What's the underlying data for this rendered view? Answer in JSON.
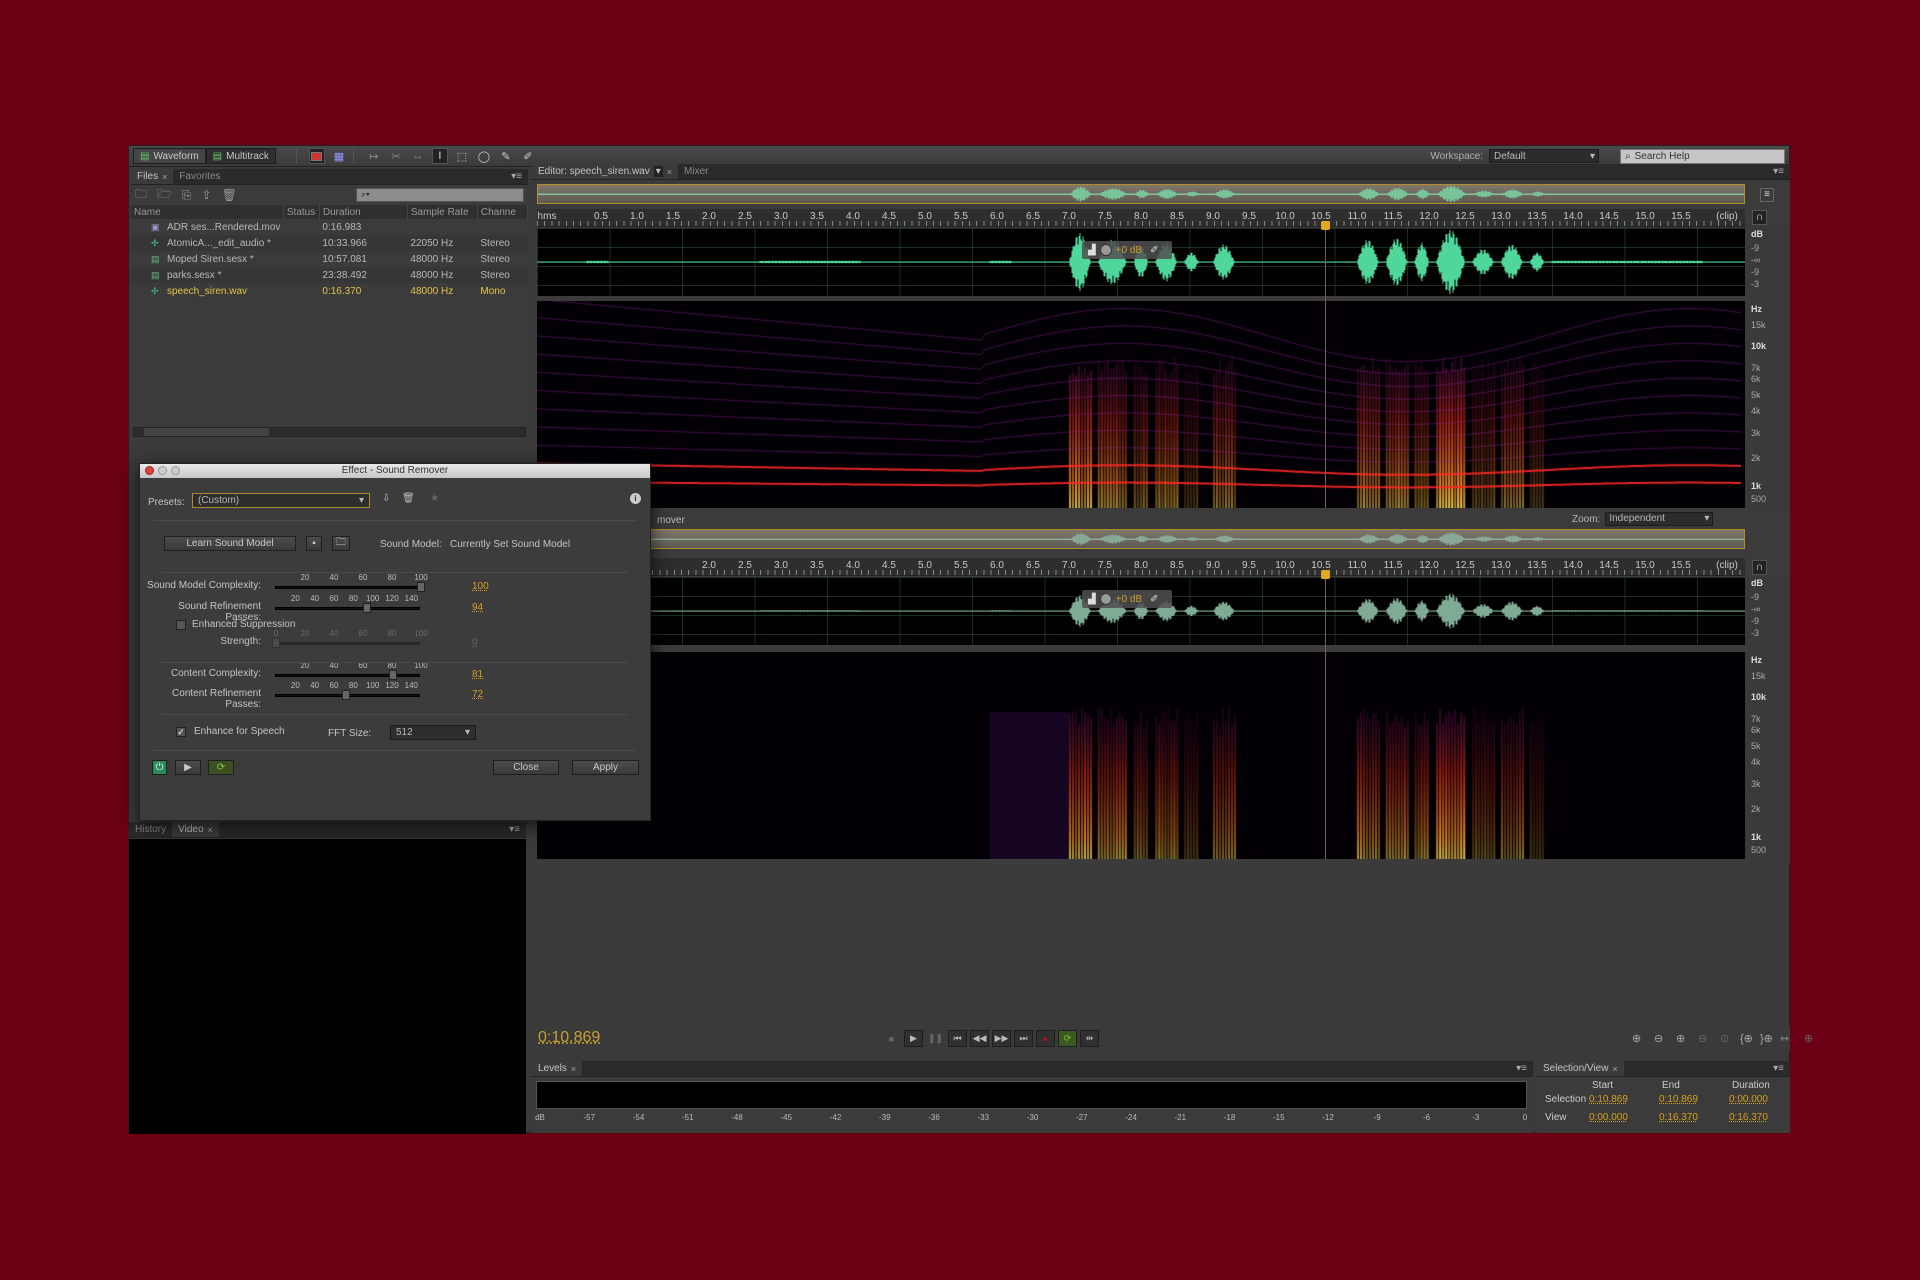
{
  "toolbar": {
    "modes": [
      {
        "label": "Waveform",
        "icon": "waveform-view-icon",
        "active": true
      },
      {
        "label": "Multitrack",
        "icon": "multitrack-view-icon",
        "active": false
      }
    ],
    "tools": [
      "spectral-frequency-display-icon",
      "spectral-pitch-display-icon",
      "move-tool-icon",
      "razor-tool-icon",
      "slip-tool-icon",
      "time-selection-tool-icon",
      "marquee-tool-icon",
      "lasso-tool-icon",
      "paintbrush-tool-icon",
      "spot-healing-brush-icon"
    ],
    "workspace_label": "Workspace:",
    "workspace_value": "Default",
    "search_placeholder": "Search Help"
  },
  "files_panel": {
    "tabs": [
      {
        "label": "Files",
        "closable": true,
        "active": true
      },
      {
        "label": "Favorites",
        "closable": false,
        "active": false
      }
    ],
    "columns": [
      "Name",
      "Status",
      "Duration",
      "Sample Rate",
      "Channe"
    ],
    "rows": [
      {
        "name": "ADR ses...Rendered.mov",
        "type": "video",
        "status": "",
        "duration": "0:16.983",
        "rate": "",
        "channels": ""
      },
      {
        "name": "AtomicA..._edit_audio *",
        "type": "audio",
        "status": "",
        "duration": "10:33.966",
        "rate": "22050 Hz",
        "channels": "Stereo"
      },
      {
        "name": "Moped Siren.sesx *",
        "type": "session",
        "status": "",
        "duration": "10:57.081",
        "rate": "48000 Hz",
        "channels": "Stereo"
      },
      {
        "name": "parks.sesx *",
        "type": "session",
        "status": "",
        "duration": "23:38.492",
        "rate": "48000 Hz",
        "channels": "Stereo"
      },
      {
        "name": "speech_siren.wav",
        "type": "audio",
        "status": "",
        "duration": "0:16.370",
        "rate": "48000 Hz",
        "channels": "Mono",
        "selected": true
      }
    ]
  },
  "history_panel": {
    "tabs": [
      {
        "label": "History",
        "active": false
      },
      {
        "label": "Video",
        "active": true,
        "closable": true
      }
    ]
  },
  "editor": {
    "tabs": [
      {
        "label": "Editor: speech_siren.wav",
        "active": true,
        "closable": true
      },
      {
        "label": "Mixer",
        "active": false
      }
    ],
    "ruler_unit": "hms",
    "ruler_ticks": [
      "0.5",
      "1.0",
      "1.5",
      "2.0",
      "2.5",
      "3.0",
      "3.5",
      "4.0",
      "4.5",
      "5.0",
      "5.5",
      "6.0",
      "6.5",
      "7.0",
      "7.5",
      "8.0",
      "8.5",
      "9.0",
      "9.5",
      "10.0",
      "10.5",
      "11.0",
      "11.5",
      "12.0",
      "12.5",
      "13.0",
      "13.5",
      "14.0",
      "14.5",
      "15.0",
      "15.5"
    ],
    "ruler_end": "(clip)",
    "db_scale": [
      "dB",
      "-9",
      "-∞",
      "-9",
      "-3"
    ],
    "hz_scale": [
      "Hz",
      "15k",
      "10k",
      "7k",
      "6k",
      "5k",
      "4k",
      "3k",
      "2k",
      "1k",
      "500"
    ],
    "hud_gain": "+0 dB",
    "comparison_label": "mover",
    "zoom_label": "Zoom:",
    "zoom_value": "Independent",
    "playhead_time_s": 10.869,
    "duration_s": 16.37
  },
  "dialog": {
    "title": "Effect - Sound Remover",
    "presets_label": "Presets:",
    "presets_value": "(Custom)",
    "learn_button": "Learn Sound Model",
    "sound_model_label": "Sound Model:",
    "sound_model_value": "Currently Set Sound Model",
    "sliders": [
      {
        "label": "Sound Model Complexity:",
        "ticks": [
          "20",
          "40",
          "60",
          "80",
          "100"
        ],
        "min": 0,
        "max": 100,
        "value": "100",
        "enabled": true
      },
      {
        "label": "Sound Refinement Passes:",
        "ticks": [
          "20",
          "40",
          "60",
          "80",
          "100",
          "120",
          "140"
        ],
        "min": 0,
        "max": 150,
        "value": "94",
        "enabled": true
      },
      {
        "label": "Strength:",
        "ticks": [
          "0",
          "20",
          "40",
          "60",
          "80",
          "100"
        ],
        "min": 0,
        "max": 100,
        "value": "0",
        "enabled": false
      },
      {
        "label": "Content Complexity:",
        "ticks": [
          "20",
          "40",
          "60",
          "80",
          "100"
        ],
        "min": 0,
        "max": 100,
        "value": "81",
        "enabled": true
      },
      {
        "label": "Content Refinement Passes:",
        "ticks": [
          "20",
          "40",
          "60",
          "80",
          "100",
          "120",
          "140"
        ],
        "min": 0,
        "max": 150,
        "value": "72",
        "enabled": true
      }
    ],
    "enhanced_suppression_label": "Enhanced Suppression",
    "enhanced_suppression_checked": false,
    "enhance_speech_label": "Enhance for Speech",
    "enhance_speech_checked": true,
    "fft_label": "FFT Size:",
    "fft_value": "512",
    "close_button": "Close",
    "apply_button": "Apply"
  },
  "transport": {
    "time": "0:10.869",
    "buttons": [
      "stop-icon",
      "play-icon",
      "pause-icon",
      "go-to-start-icon",
      "rewind-icon",
      "fast-forward-icon",
      "go-to-end-icon",
      "record-icon",
      "loop-icon",
      "skip-selection-icon"
    ],
    "zoom_buttons": [
      "zoom-in-amplitude-icon",
      "zoom-out-amplitude-icon",
      "zoom-in-time-icon",
      "zoom-out-time-icon",
      "zoom-out-full-icon",
      "zoom-to-in-point-icon",
      "zoom-to-out-point-icon",
      "zoom-to-selection-icon",
      "zoom-reset-icon"
    ]
  },
  "levels": {
    "tab": "Levels",
    "scale": [
      "dB",
      "-57",
      "-54",
      "-51",
      "-48",
      "-45",
      "-42",
      "-39",
      "-36",
      "-33",
      "-30",
      "-27",
      "-24",
      "-21",
      "-18",
      "-15",
      "-12",
      "-9",
      "-6",
      "-3",
      "0"
    ]
  },
  "selection_view": {
    "tab": "Selection/View",
    "headers": [
      "Start",
      "End",
      "Duration"
    ],
    "rows": [
      {
        "label": "Selection",
        "start": "0:10.869",
        "end": "0:10.869",
        "duration": "0:00.000"
      },
      {
        "label": "View",
        "start": "0:00.000",
        "end": "0:16.370",
        "duration": "0:16.370"
      }
    ]
  }
}
